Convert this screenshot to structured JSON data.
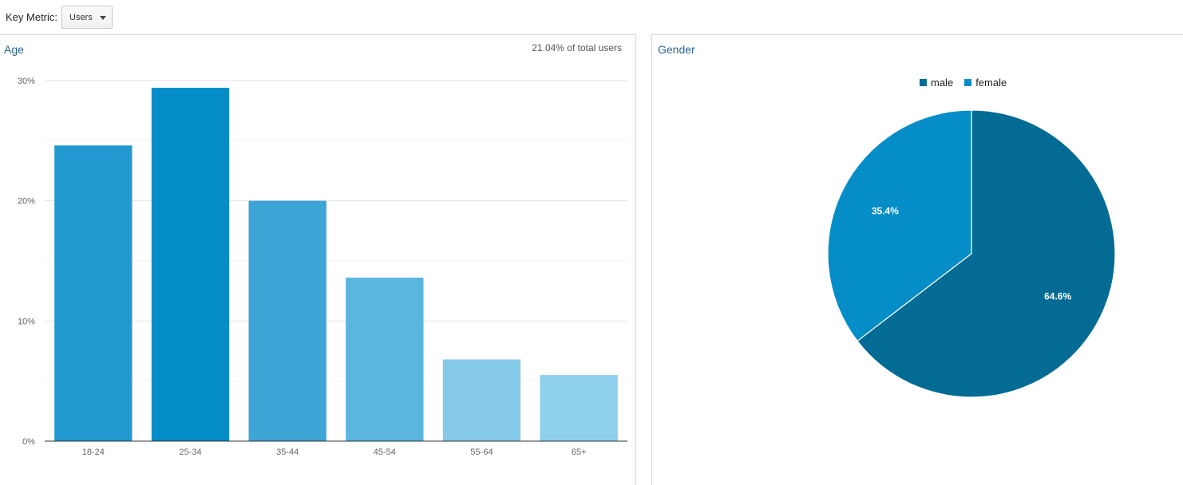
{
  "toolbar": {
    "key_metric_label": "Key Metric:",
    "metric_value": "Users"
  },
  "age_panel": {
    "title": "Age",
    "total_note": "21.04% of total users"
  },
  "gender_panel": {
    "title": "Gender"
  },
  "chart_data": [
    {
      "type": "bar",
      "title": "Age",
      "categories": [
        "18-24",
        "25-34",
        "35-44",
        "45-54",
        "55-64",
        "65+"
      ],
      "values": [
        24.6,
        29.4,
        20.0,
        13.6,
        6.8,
        5.5
      ],
      "colors": [
        "#2199d0",
        "#058dc7",
        "#3ca5d5",
        "#5ab5df",
        "#86cae9",
        "#8ecfeb"
      ],
      "yticks": [
        "0%",
        "10%",
        "20%",
        "30%"
      ],
      "ylim": [
        0,
        30
      ],
      "unit": "%",
      "xlabel": "",
      "ylabel": "",
      "grid": true
    },
    {
      "type": "pie",
      "title": "Gender",
      "legend_position": "top",
      "slices": [
        {
          "name": "male",
          "value": 64.6,
          "label": "64.6%",
          "color": "#046b94"
        },
        {
          "name": "female",
          "value": 35.4,
          "label": "35.4%",
          "color": "#058dc7"
        }
      ]
    }
  ]
}
